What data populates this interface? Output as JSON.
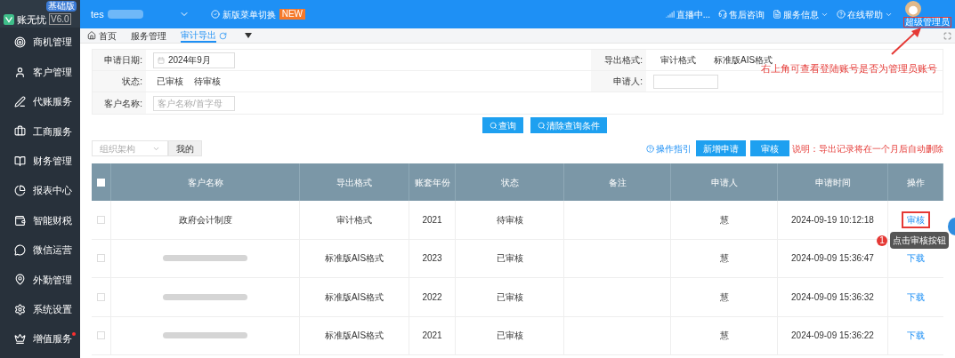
{
  "brand": {
    "name": "账无忧",
    "version": "V6.0",
    "edition": "基础版"
  },
  "topbar": {
    "user": "tes",
    "menu_switch": "新版菜单切换",
    "new_badge": "NEW",
    "links": [
      {
        "label": "直播中...",
        "kind": "signal",
        "dropdown": false
      },
      {
        "label": "售后咨询",
        "kind": "headset",
        "dropdown": false
      },
      {
        "label": "服务信息",
        "kind": "doc",
        "dropdown": true
      },
      {
        "label": "在线帮助",
        "kind": "help",
        "dropdown": true
      }
    ],
    "role": "超级管理员"
  },
  "sidebar": {
    "items": [
      {
        "label": "商机管理",
        "dot": false
      },
      {
        "label": "客户管理",
        "dot": false
      },
      {
        "label": "代账服务",
        "dot": false
      },
      {
        "label": "工商服务",
        "dot": false
      },
      {
        "label": "财务管理",
        "dot": false
      },
      {
        "label": "报表中心",
        "dot": false
      },
      {
        "label": "智能财税",
        "dot": false
      },
      {
        "label": "微信运营",
        "dot": false
      },
      {
        "label": "外勤管理",
        "dot": false
      },
      {
        "label": "系统设置",
        "dot": false
      },
      {
        "label": "增值服务",
        "dot": true
      }
    ]
  },
  "tabs": [
    {
      "label": "首页",
      "selected": false,
      "kind": "home"
    },
    {
      "label": "服务管理",
      "selected": false,
      "kind": "page"
    },
    {
      "label": "审计导出",
      "selected": true,
      "kind": "page"
    }
  ],
  "filters": {
    "date_label": "申请日期:",
    "date_value": "2024年9月",
    "status_label": "状态:",
    "status_options": [
      {
        "label": "已审核",
        "selected": false
      },
      {
        "label": "待审核",
        "selected": false
      }
    ],
    "customer_label": "客户名称:",
    "customer_placeholder": "客户名称/首字母",
    "format_label": "导出格式:",
    "format_options": [
      {
        "label": "审计格式",
        "selected": false
      },
      {
        "label": "标准版AIS格式",
        "selected": false
      }
    ],
    "applicant_label": "申请人:"
  },
  "actions": {
    "search": "查询",
    "clear": "清除查询条件"
  },
  "toolbar": {
    "org_placeholder": "组织架构",
    "mine": "我的",
    "guide": "操作指引",
    "new_request": "新增申请",
    "review": "审核",
    "note": "说明：导出记录将在一个月后自动删除"
  },
  "table": {
    "all_checked": false,
    "columns": [
      "客户名称",
      "导出格式",
      "账套年份",
      "状态",
      "备注",
      "申请人",
      "申请时间",
      "操作"
    ],
    "rows": [
      {
        "checked": false,
        "name": "政府会计制度",
        "redacted": false,
        "format": "审计格式",
        "year": "2021",
        "status": "待审核",
        "applicant": "慧",
        "time": "2024-09-19 10:12:18",
        "action": "审核",
        "highlighted": true
      },
      {
        "checked": false,
        "name": "",
        "redacted": true,
        "format": "标准版AIS格式",
        "year": "2023",
        "status": "已审核",
        "applicant": "慧",
        "time": "2024-09-09 15:36:47",
        "action": "下载",
        "highlighted": false
      },
      {
        "checked": false,
        "name": "",
        "redacted": true,
        "format": "标准版AIS格式",
        "year": "2022",
        "status": "已审核",
        "applicant": "慧",
        "time": "2024-09-09 15:36:32",
        "action": "下载",
        "highlighted": false
      },
      {
        "checked": false,
        "name": "",
        "redacted": true,
        "format": "标准版AIS格式",
        "year": "2021",
        "status": "已审核",
        "applicant": "慧",
        "time": "2024-09-09 15:36:22",
        "action": "下载",
        "highlighted": false
      }
    ]
  },
  "annotations": {
    "admin_note": "右上角可查看登陆账号是否为管理员账号",
    "tip": "点击审核按钮",
    "tip_step": "1"
  }
}
